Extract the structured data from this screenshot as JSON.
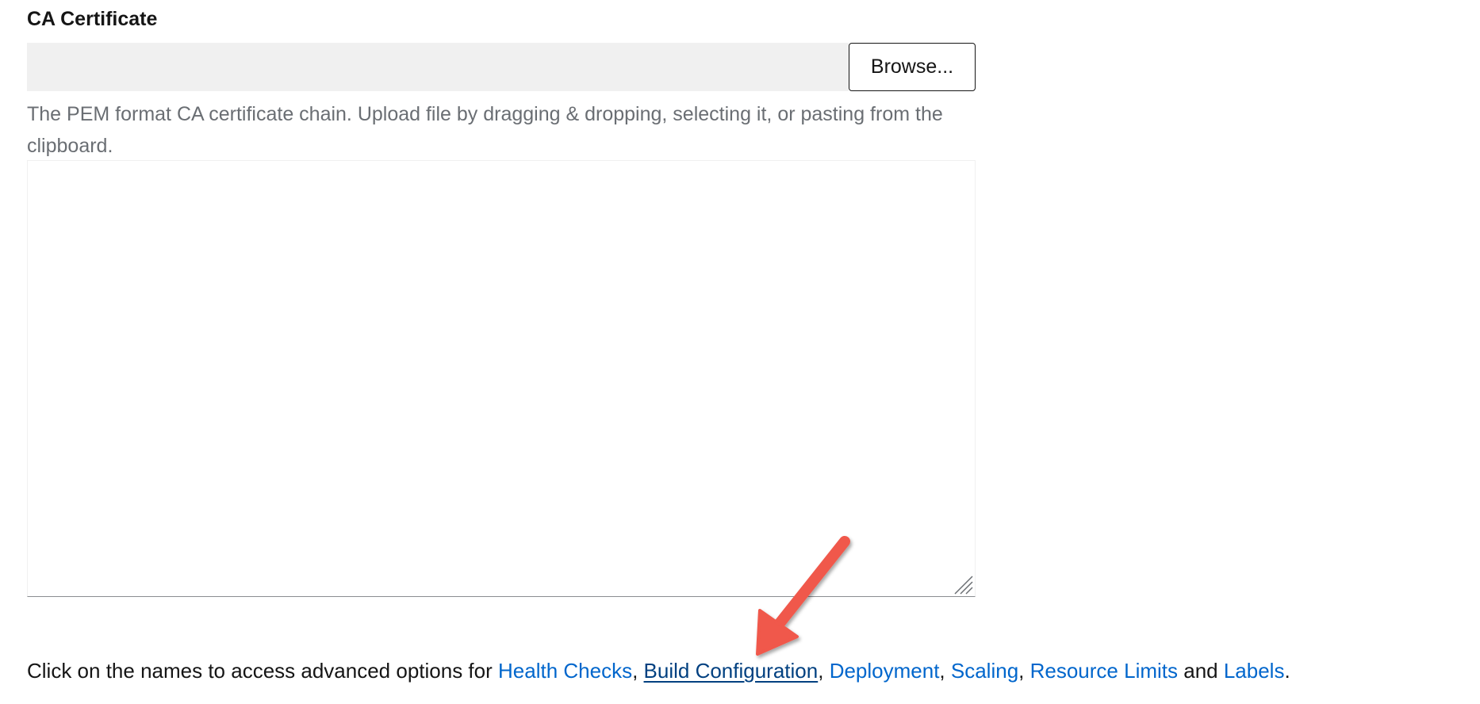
{
  "ca_certificate": {
    "label": "CA Certificate",
    "filename_value": "",
    "browse_label": "Browse...",
    "helper_text": "The PEM format CA certificate chain. Upload file by dragging & dropping, selecting it, or pasting from the clipboard.",
    "textarea_value": ""
  },
  "advanced": {
    "intro": "Click on the names to access advanced options for ",
    "links": [
      {
        "label": "Health Checks"
      },
      {
        "label": "Build Configuration"
      },
      {
        "label": "Deployment"
      },
      {
        "label": "Scaling"
      },
      {
        "label": "Resource Limits"
      },
      {
        "label": "Labels"
      }
    ],
    "separator": ", ",
    "conjunction": " and ",
    "terminator": "."
  },
  "colors": {
    "link": "#0066cc",
    "link_hover": "#004080",
    "annotation_arrow": "#f0584b",
    "helper_text": "#6a6e73",
    "field_background": "#f0f0f0"
  },
  "icons": {
    "resize_handle": "resize-grip-icon",
    "annotation": "arrow-annotation-icon"
  }
}
